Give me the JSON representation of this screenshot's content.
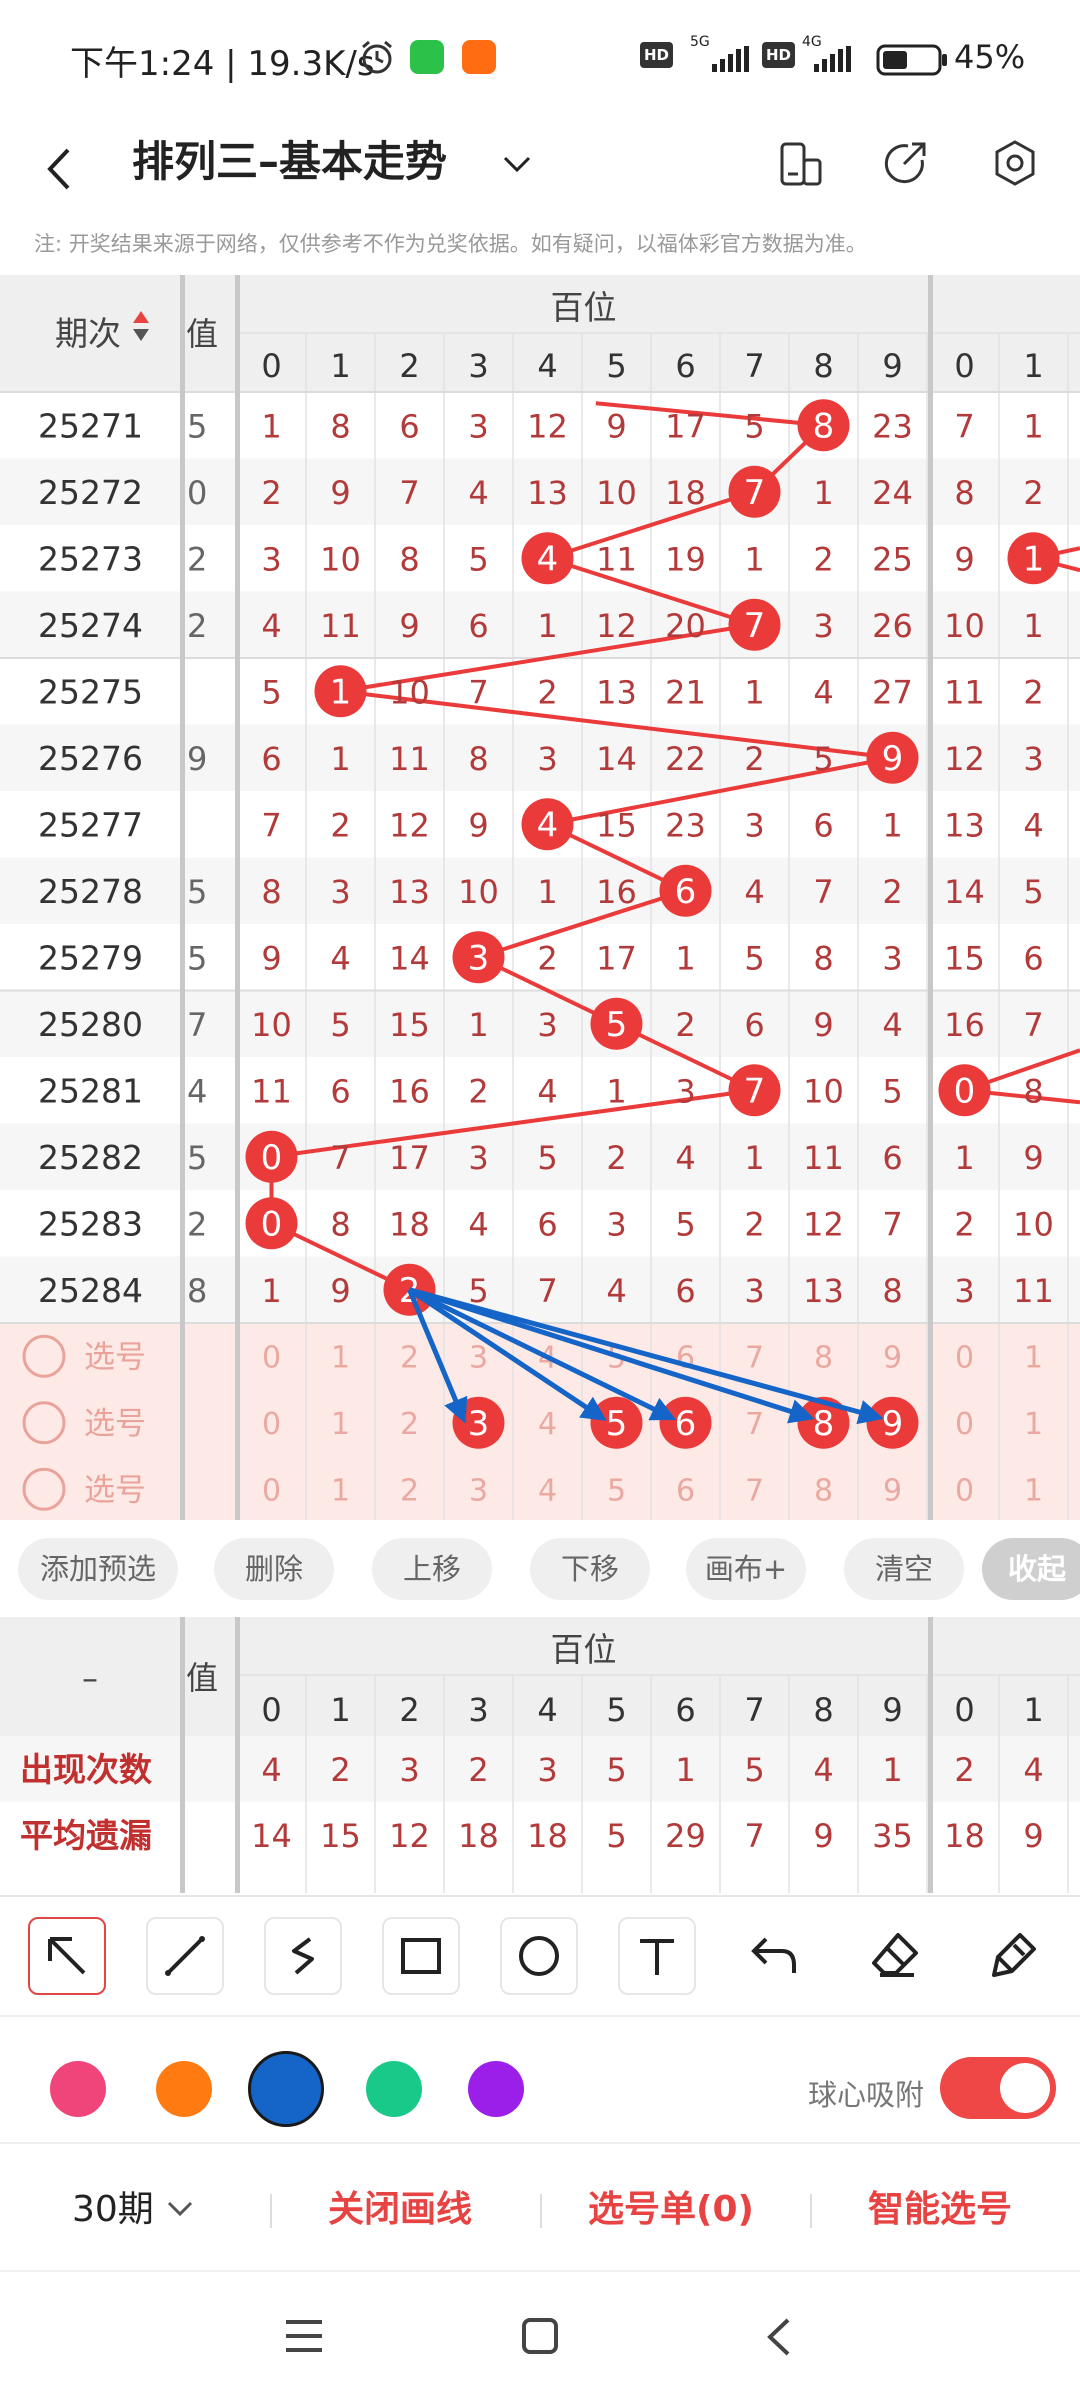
{
  "status_bar": {
    "time": "下午1:24 | 19.3K/s",
    "net1": "5G",
    "net2": "4G",
    "badge1": "HD",
    "badge2": "HD",
    "battery": "45%"
  },
  "header": {
    "title": "排列三–基本走势"
  },
  "notice": "注: 开奖结果来源于网络，仅供参考不作为兑奖依据。如有疑问，以福体彩官方数据为准。",
  "table": {
    "col_issue_label": "期次",
    "col_value_label": "值",
    "group_label": "百位",
    "digits": [
      "0",
      "1",
      "2",
      "3",
      "4",
      "5",
      "6",
      "7",
      "8",
      "9"
    ],
    "right_digits": [
      "0",
      "1"
    ],
    "rows": [
      {
        "issue": "25271",
        "v": "5",
        "cells": [
          "1",
          "8",
          "6",
          "3",
          "12",
          "9",
          "17",
          "5",
          "8",
          "23"
        ],
        "hit": 8,
        "r": [
          "7",
          "1"
        ],
        "rhit": -1
      },
      {
        "issue": "25272",
        "v": "0",
        "cells": [
          "2",
          "9",
          "7",
          "4",
          "13",
          "10",
          "18",
          "7",
          "1",
          "24"
        ],
        "hit": 7,
        "r": [
          "8",
          "2"
        ],
        "rhit": -1
      },
      {
        "issue": "25273",
        "v": "2",
        "cells": [
          "3",
          "10",
          "8",
          "5",
          "4",
          "11",
          "19",
          "1",
          "2",
          "25"
        ],
        "hit": 4,
        "r": [
          "9",
          "1"
        ],
        "rhit": 1
      },
      {
        "issue": "25274",
        "v": "2",
        "cells": [
          "4",
          "11",
          "9",
          "6",
          "1",
          "12",
          "20",
          "7",
          "3",
          "26"
        ],
        "hit": 7,
        "r": [
          "10",
          "1"
        ],
        "rhit": -1
      },
      {
        "issue": "25275",
        "v": "",
        "cells": [
          "5",
          "1",
          "10",
          "7",
          "2",
          "13",
          "21",
          "1",
          "4",
          "27"
        ],
        "hit": 1,
        "r": [
          "11",
          "2"
        ],
        "rhit": -1
      },
      {
        "issue": "25276",
        "v": "9",
        "cells": [
          "6",
          "1",
          "11",
          "8",
          "3",
          "14",
          "22",
          "2",
          "5",
          "9"
        ],
        "hit": 9,
        "r": [
          "12",
          "3"
        ],
        "rhit": -1
      },
      {
        "issue": "25277",
        "v": "",
        "cells": [
          "7",
          "2",
          "12",
          "9",
          "4",
          "15",
          "23",
          "3",
          "6",
          "1"
        ],
        "hit": 4,
        "r": [
          "13",
          "4"
        ],
        "rhit": -1
      },
      {
        "issue": "25278",
        "v": "5",
        "cells": [
          "8",
          "3",
          "13",
          "10",
          "1",
          "16",
          "6",
          "4",
          "7",
          "2"
        ],
        "hit": 6,
        "r": [
          "14",
          "5"
        ],
        "rhit": -1
      },
      {
        "issue": "25279",
        "v": "5",
        "cells": [
          "9",
          "4",
          "14",
          "3",
          "2",
          "17",
          "1",
          "5",
          "8",
          "3"
        ],
        "hit": 3,
        "r": [
          "15",
          "6"
        ],
        "rhit": -1
      },
      {
        "issue": "25280",
        "v": "7",
        "cells": [
          "10",
          "5",
          "15",
          "1",
          "3",
          "5",
          "2",
          "6",
          "9",
          "4"
        ],
        "hit": 5,
        "r": [
          "16",
          "7"
        ],
        "rhit": -1
      },
      {
        "issue": "25281",
        "v": "4",
        "cells": [
          "11",
          "6",
          "16",
          "2",
          "4",
          "1",
          "3",
          "7",
          "10",
          "5"
        ],
        "hit": 7,
        "r": [
          "0",
          "8"
        ],
        "rhit": 0
      },
      {
        "issue": "25282",
        "v": "5",
        "cells": [
          "0",
          "7",
          "17",
          "3",
          "5",
          "2",
          "4",
          "1",
          "11",
          "6"
        ],
        "hit": 0,
        "r": [
          "1",
          "9"
        ],
        "rhit": -1
      },
      {
        "issue": "25283",
        "v": "2",
        "cells": [
          "0",
          "8",
          "18",
          "4",
          "6",
          "3",
          "5",
          "2",
          "12",
          "7"
        ],
        "hit": 0,
        "r": [
          "2",
          "10"
        ],
        "rhit": -1
      },
      {
        "issue": "25284",
        "v": "8",
        "cells": [
          "1",
          "9",
          "2",
          "5",
          "7",
          "4",
          "6",
          "3",
          "13",
          "8"
        ],
        "hit": 2,
        "r": [
          "3",
          "11"
        ],
        "rhit": -1
      }
    ],
    "pick_rows": [
      {
        "label": "选号",
        "selected": []
      },
      {
        "label": "选号",
        "selected": [
          3,
          5,
          6,
          8,
          9
        ]
      },
      {
        "label": "选号",
        "selected": []
      }
    ]
  },
  "actions": [
    "添加预选",
    "删除",
    "上移",
    "下移",
    "画布+",
    "清空",
    "收起"
  ],
  "stats": {
    "dash": "–",
    "value_label": "值",
    "group_label": "百位",
    "digits": [
      "0",
      "1",
      "2",
      "3",
      "4",
      "5",
      "6",
      "7",
      "8",
      "9"
    ],
    "right_digits": [
      "0",
      "1"
    ],
    "rows": [
      {
        "label": "出现次数",
        "cells": [
          "4",
          "2",
          "3",
          "2",
          "3",
          "5",
          "1",
          "5",
          "4",
          "1"
        ],
        "r": [
          "2",
          "4"
        ]
      },
      {
        "label": "平均遗漏",
        "cells": [
          "14",
          "15",
          "12",
          "18",
          "18",
          "5",
          "29",
          "7",
          "9",
          "35"
        ],
        "r": [
          "18",
          "9"
        ]
      }
    ]
  },
  "tools": [
    "arrow-tool-icon",
    "line-tool-icon",
    "freehand-tool-icon",
    "rectangle-tool-icon",
    "circle-tool-icon",
    "text-tool-icon",
    "undo-icon",
    "eraser-icon",
    "clear-brush-icon"
  ],
  "colors": [
    "#f0457a",
    "#ff7a10",
    "#1565c8",
    "#18c98a",
    "#9b1fe8"
  ],
  "snap_label": "球心吸附",
  "bottom_bar": {
    "period": "30期",
    "close_line": "关闭画线",
    "pick_list": "选号单(0)",
    "smart_pick": "智能选号"
  },
  "accent": "#e84343",
  "hit_color": "#ea3a3a",
  "pick_blue": "#1565c8"
}
